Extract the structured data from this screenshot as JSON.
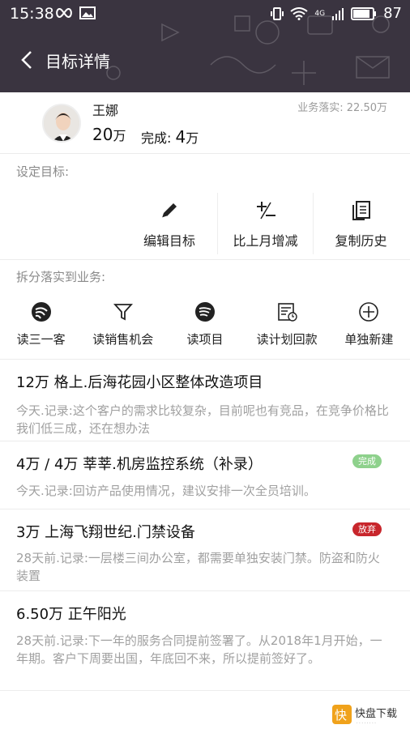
{
  "status": {
    "time": "15:38",
    "network": "4G",
    "battery": "87"
  },
  "nav": {
    "title": "目标详情"
  },
  "profile": {
    "name": "王娜",
    "amount_value": "20",
    "amount_unit": "万",
    "done_label": "完成:",
    "done_value": "4",
    "done_unit": "万",
    "landed": "业务落实: 22.50万"
  },
  "set_target": {
    "label": "设定目标:",
    "actions": [
      {
        "label": "编辑目标",
        "icon": "pencil-icon"
      },
      {
        "label": "比上月增减",
        "icon": "plus-minus-icon"
      },
      {
        "label": "复制历史",
        "icon": "copy-document-icon"
      }
    ]
  },
  "split": {
    "label": "拆分落实到业务:",
    "actions": [
      {
        "label": "读三一客",
        "icon": "signal-icon"
      },
      {
        "label": "读销售机会",
        "icon": "funnel-icon"
      },
      {
        "label": "读项目",
        "icon": "project-circle-icon"
      },
      {
        "label": "读计划回款",
        "icon": "calendar-clock-icon"
      },
      {
        "label": "单独新建",
        "icon": "plus-circle-icon"
      }
    ]
  },
  "deals": [
    {
      "title": "12万  格上.后海花园小区整体改造项目",
      "note": "今天.记录:这个客户的需求比较复杂，目前呢也有竞品，在竞争价格比我们低三成，还在想办法",
      "badge": ""
    },
    {
      "title": "4万 / 4万  莘莘.机房监控系统（补录）",
      "note": "今天.记录:回访产品使用情况，建议安排一次全员培训。",
      "badge": "完成",
      "badge_color": "#8ed18c"
    },
    {
      "title": "3万  上海飞翔世纪.门禁设备",
      "note": "28天前.记录:一层楼三间办公室，都需要单独安装门禁。防盗和防火装置",
      "badge": "放弃",
      "badge_color": "#c8262c"
    },
    {
      "title": "6.50万  正午阳光",
      "note": "28天前.记录:下一年的服务合同提前签署了。从2018年1月开始，一年期。客户下周要出国，年底回不来，所以提前签好了。",
      "badge": ""
    }
  ],
  "watermark": {
    "text": "快盘下载"
  }
}
